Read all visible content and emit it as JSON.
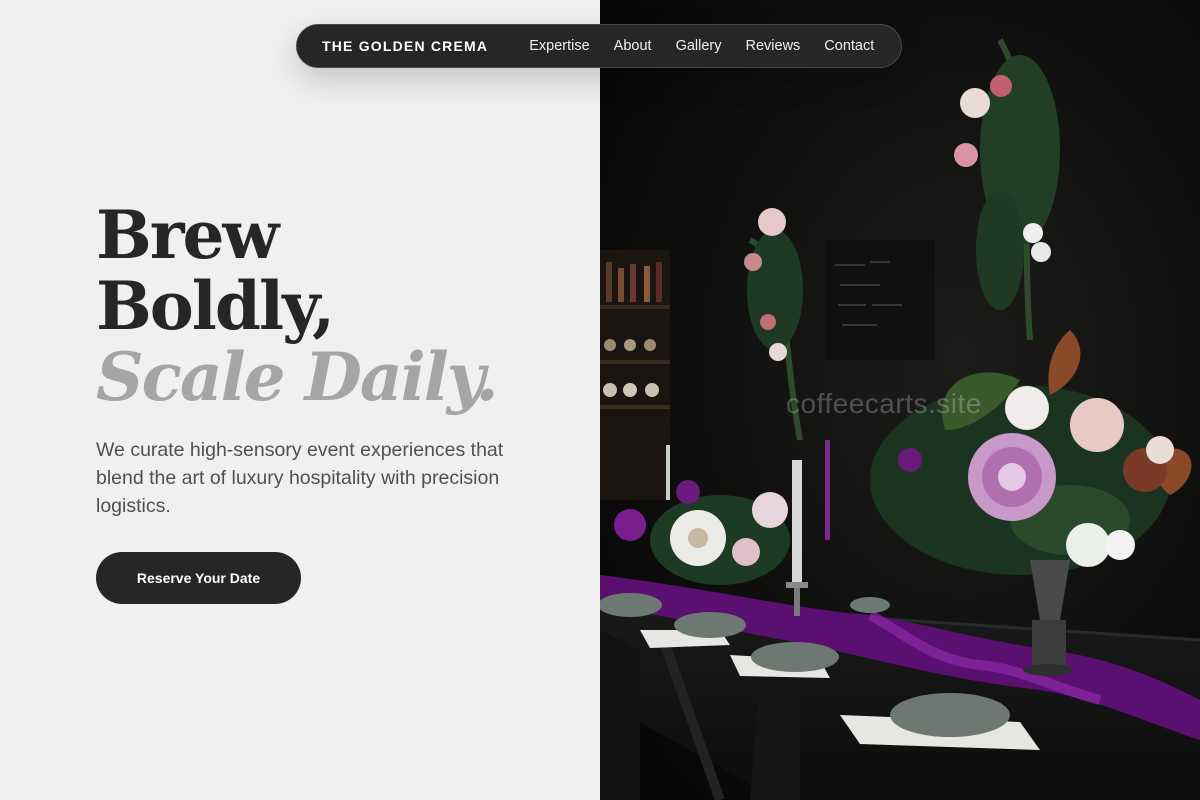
{
  "nav": {
    "brand": "THE GOLDEN CREMA",
    "links": [
      "Expertise",
      "About",
      "Gallery",
      "Reviews",
      "Contact"
    ]
  },
  "hero": {
    "headline_line1": "Brew",
    "headline_line2": "Boldly,",
    "headline_line3": "Scale Daily.",
    "subtext": "We curate high-sensory event experiences that blend the art of luxury hospitality with precision logistics.",
    "cta_label": "Reserve Your Date"
  },
  "image": {
    "watermark": "coffeecarts.site",
    "description_icon": "event-table-florals-photo"
  },
  "colors": {
    "background": "#f0f0f0",
    "nav_bg": "#262626",
    "headline": "#262626",
    "headline_muted": "#a5a5a5",
    "body_text": "#505050",
    "cta_bg": "#262626",
    "accent_purple": "#6b1e86"
  }
}
